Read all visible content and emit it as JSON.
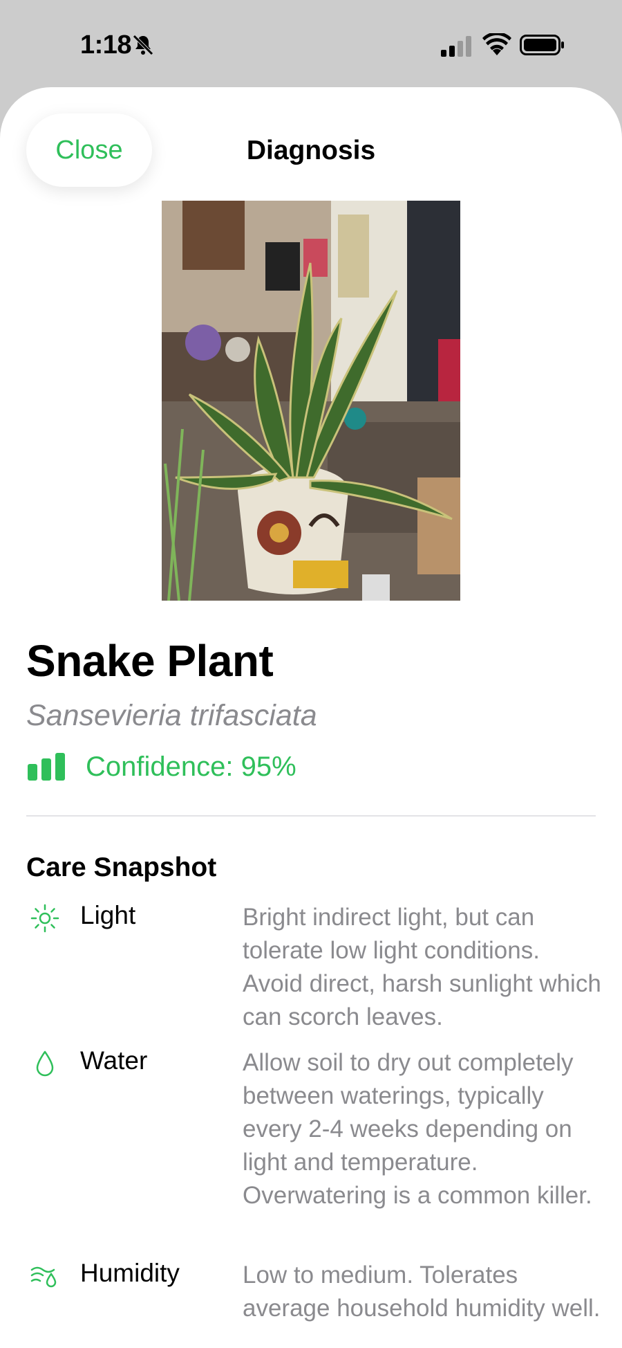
{
  "status_bar": {
    "time": "1:18"
  },
  "nav": {
    "close_label": "Close",
    "title": "Diagnosis"
  },
  "plant": {
    "name": "Snake Plant",
    "scientific_name": "Sansevieria trifasciata",
    "confidence_text": "Confidence: 95%"
  },
  "care": {
    "title": "Care Snapshot",
    "items": [
      {
        "label": "Light",
        "icon": "sun-icon",
        "description": "Bright indirect light, but can tolerate low light conditions. Avoid direct, harsh sunlight which can scorch leaves."
      },
      {
        "label": "Water",
        "icon": "water-drop-icon",
        "description": "Allow soil to dry out completely between waterings, typically every 2-4 weeks depending on light and temperature. Overwatering is a common killer."
      },
      {
        "label": "Humidity",
        "icon": "humidity-icon",
        "description": "Low to medium. Tolerates average household humidity well."
      }
    ]
  },
  "colors": {
    "accent": "#2fbf5a",
    "secondary_text": "#8a8a8e",
    "status_bar_bg": "#cccccc"
  }
}
